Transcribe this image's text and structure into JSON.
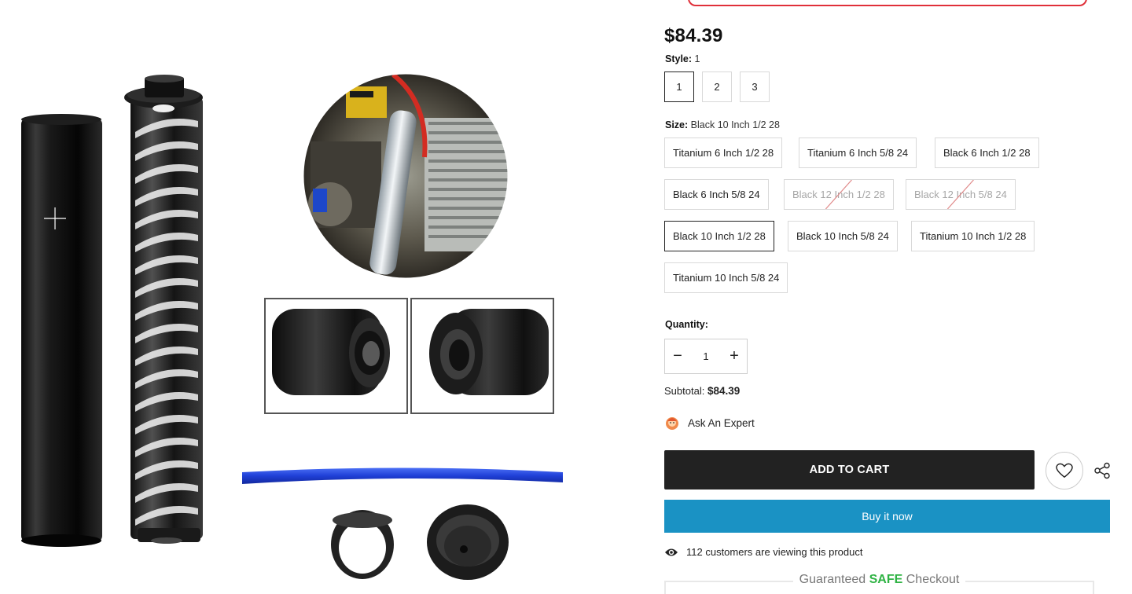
{
  "product": {
    "price": "$84.39"
  },
  "style": {
    "label": "Style:",
    "selected": "1",
    "options": [
      "1",
      "2",
      "3"
    ]
  },
  "size": {
    "label": "Size:",
    "selected": "Black 10 Inch 1/2 28",
    "options": [
      {
        "label": "Titanium 6 Inch 1/2 28",
        "state": "available"
      },
      {
        "label": "Titanium 6 Inch 5/8 24",
        "state": "available"
      },
      {
        "label": "Black 6 Inch 1/2 28",
        "state": "available"
      },
      {
        "label": "Black 6 Inch 5/8 24",
        "state": "available"
      },
      {
        "label": "Black 12 Inch 1/2 28",
        "state": "sold-out"
      },
      {
        "label": "Black 12 Inch 5/8 24",
        "state": "sold-out"
      },
      {
        "label": "Black 10 Inch 1/2 28",
        "state": "selected"
      },
      {
        "label": "Black 10 Inch 5/8 24",
        "state": "available"
      },
      {
        "label": "Titanium 10 Inch 1/2 28",
        "state": "available"
      },
      {
        "label": "Titanium 10 Inch 5/8 24",
        "state": "available"
      }
    ]
  },
  "quantity": {
    "label": "Quantity:",
    "value": "1",
    "minus": "−",
    "plus": "+"
  },
  "subtotal": {
    "label": "Subtotal:",
    "value": "$84.39"
  },
  "expert": {
    "label": "Ask An Expert",
    "icon": "expert-avatar-icon"
  },
  "actions": {
    "add_to_cart": "ADD TO CART",
    "buy_now": "Buy it now",
    "wishlist_icon": "heart-icon",
    "share_icon": "share-icon"
  },
  "viewing": {
    "text": "112 customers are viewing this product",
    "icon": "eye-icon"
  },
  "checkout": {
    "prefix": "Guaranteed",
    "highlight": "SAFE",
    "suffix": "Checkout"
  },
  "colors": {
    "add_to_cart_bg": "#222222",
    "buy_now_bg": "#1a92c4",
    "safe_green": "#2fb344",
    "alert_border": "#e0303a"
  }
}
